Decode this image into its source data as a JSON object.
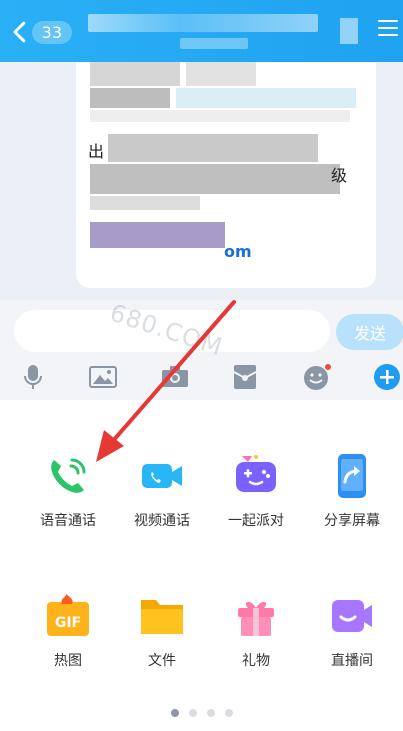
{
  "header": {
    "unread_count": "33"
  },
  "chat": {
    "partial_text_1": "出",
    "partial_text_2": "级",
    "partial_link": "om"
  },
  "input": {
    "send_label": "发送",
    "watermark": "680.COM"
  },
  "toolbar": {
    "tools": [
      "microphone-icon",
      "image-icon",
      "camera-icon",
      "red-packet-icon",
      "emoji-icon",
      "plus-icon"
    ]
  },
  "panel": {
    "items": [
      {
        "label": "语音通话",
        "icon": "phone-icon",
        "color": "#2bc46a"
      },
      {
        "label": "视频通话",
        "icon": "video-camera-icon",
        "color": "#29b6f6"
      },
      {
        "label": "一起派对",
        "icon": "party-game-icon",
        "color": "#7b61ff"
      },
      {
        "label": "分享屏幕",
        "icon": "share-screen-icon",
        "color": "#2f8ff0"
      },
      {
        "label": "热图",
        "icon": "gif-icon",
        "color": "#ffb21a"
      },
      {
        "label": "文件",
        "icon": "folder-icon",
        "color": "#ffc21e"
      },
      {
        "label": "礼物",
        "icon": "gift-icon",
        "color": "#ff7aa8"
      },
      {
        "label": "直播间",
        "icon": "live-room-icon",
        "color": "#a777ff"
      }
    ],
    "page_count": 4,
    "active_page": 1
  },
  "colors": {
    "header": "#1fa2f0",
    "send_disabled": "#b8e2fb",
    "arrow": "#e53935"
  }
}
